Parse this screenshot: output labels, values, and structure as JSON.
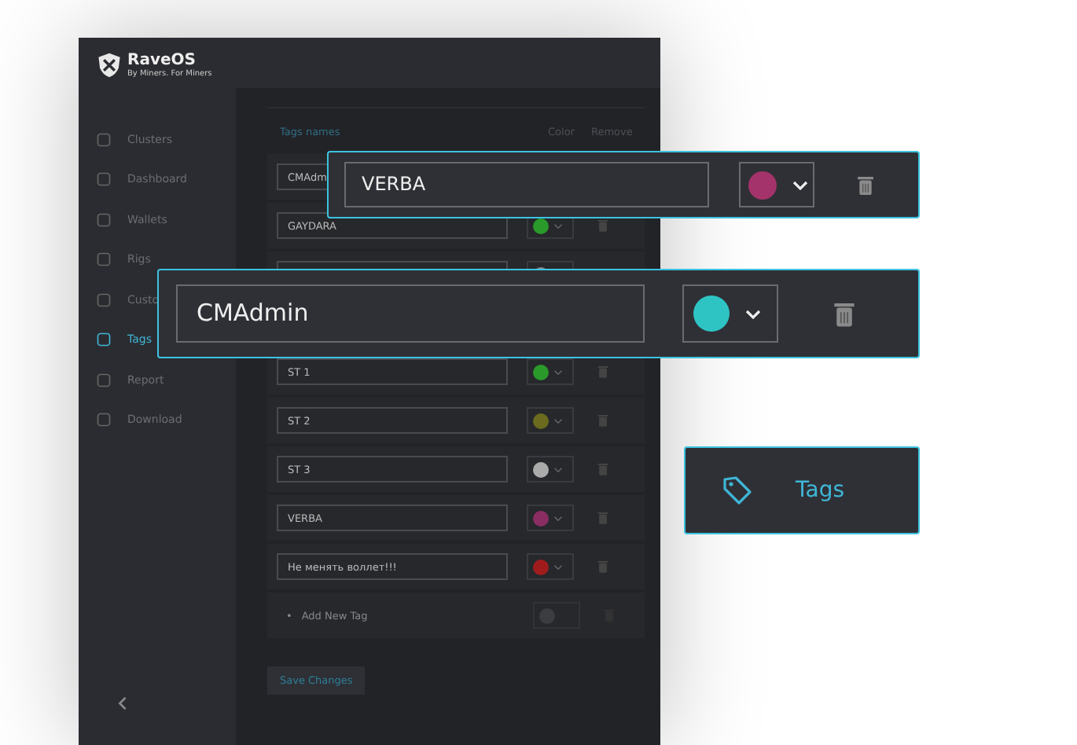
{
  "app": {
    "logo_title": "RaveOS",
    "logo_subtitle": "By Miners. For Miners"
  },
  "sidebar": {
    "items": [
      {
        "label": "Clusters",
        "selected": false
      },
      {
        "label": "Dashboard",
        "selected": false
      },
      {
        "label": "Wallets",
        "selected": false
      },
      {
        "label": "Rigs",
        "selected": false
      },
      {
        "label": "Custo",
        "selected": false
      },
      {
        "label": "Tags",
        "selected": true
      },
      {
        "label": "Report",
        "selected": false
      },
      {
        "label": "Download",
        "selected": false
      }
    ]
  },
  "table": {
    "columns": [
      "Tags names",
      "Color",
      "Remove"
    ],
    "rows": [
      {
        "name": "CMAdm"
      },
      {
        "name": "GAYDARA",
        "color": "#2a9a2a"
      },
      {
        "color": "#888888"
      },
      {
        "name": "ST 1",
        "color": "#2a9a2a"
      },
      {
        "name": "ST 2",
        "color": "#6b6a1e"
      },
      {
        "name": "ST 3",
        "color": "#aaaaaa"
      },
      {
        "name": "VERBA",
        "color": "#8a2d63"
      },
      {
        "name": "Не менять воллет!!!",
        "color": "#a01c1c"
      }
    ],
    "add_label": "Add New Tag",
    "add_bullet": "•"
  },
  "save_button": "Save Changes",
  "callouts": [
    {
      "kind": "tag-row",
      "name": "VERBA",
      "color": "#a3336a"
    },
    {
      "kind": "tag-row",
      "name": "CMAdmin",
      "color": "#2ec4c4"
    },
    {
      "kind": "nav",
      "label": "Tags"
    }
  ]
}
